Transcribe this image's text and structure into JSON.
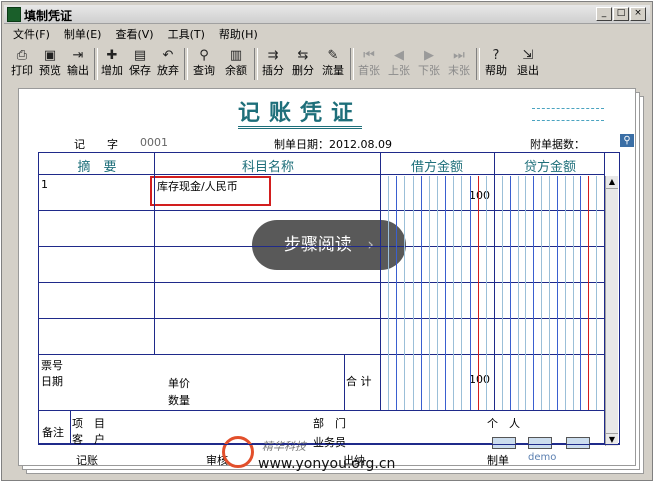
{
  "window": {
    "title": "填制凭证",
    "controls": [
      "_",
      "□",
      "×"
    ]
  },
  "menu": [
    "文件(F)",
    "制单(E)",
    "查看(V)",
    "工具(T)",
    "帮助(H)"
  ],
  "toolbar": [
    {
      "label": "打印",
      "icon": "printer-icon",
      "glyph": "⎙",
      "disabled": false
    },
    {
      "label": "预览",
      "icon": "preview-icon",
      "glyph": "▣",
      "disabled": false
    },
    {
      "label": "输出",
      "icon": "export-icon",
      "glyph": "⇥",
      "disabled": false
    },
    {
      "label": "增加",
      "icon": "add-icon",
      "glyph": "✚",
      "disabled": false
    },
    {
      "label": "保存",
      "icon": "save-icon",
      "glyph": "▤",
      "disabled": false
    },
    {
      "label": "放弃",
      "icon": "undo-icon",
      "glyph": "↶",
      "disabled": false
    },
    {
      "label": "查询",
      "icon": "binoculars-icon",
      "glyph": "⚲",
      "disabled": false
    },
    {
      "label": "余额",
      "icon": "balance-chart-icon",
      "glyph": "▥",
      "disabled": false
    },
    {
      "label": "插分",
      "icon": "insert-line-icon",
      "glyph": "⇉",
      "disabled": false
    },
    {
      "label": "删分",
      "icon": "delete-line-icon",
      "glyph": "⇆",
      "disabled": false
    },
    {
      "label": "流量",
      "icon": "cashflow-icon",
      "glyph": "✎",
      "disabled": false
    },
    {
      "label": "首张",
      "icon": "first-icon",
      "glyph": "⏮",
      "disabled": true
    },
    {
      "label": "上张",
      "icon": "prev-icon",
      "glyph": "◀",
      "disabled": true
    },
    {
      "label": "下张",
      "icon": "next-icon",
      "glyph": "▶",
      "disabled": true
    },
    {
      "label": "末张",
      "icon": "last-icon",
      "glyph": "⏭",
      "disabled": true
    },
    {
      "label": "帮助",
      "icon": "help-icon",
      "glyph": "?",
      "disabled": false
    },
    {
      "label": "退出",
      "icon": "exit-icon",
      "glyph": "⇲",
      "disabled": false
    }
  ],
  "voucher": {
    "title": "记账凭证",
    "type_label": "记　　字",
    "number": "0001",
    "date_label": "制单日期：2012.08.09",
    "attachments_label": "附单据数：",
    "columns": [
      "摘　要",
      "科目名称",
      "借方金额",
      "贷方金额"
    ],
    "rows": [
      {
        "no": "1",
        "summary": "",
        "account": "库存现金/人民币",
        "debit": "100",
        "credit": ""
      },
      {
        "no": "",
        "summary": "",
        "account": "",
        "debit": "",
        "credit": ""
      },
      {
        "no": "",
        "summary": "",
        "account": "",
        "debit": "",
        "credit": ""
      },
      {
        "no": "",
        "summary": "",
        "account": "",
        "debit": "",
        "credit": ""
      },
      {
        "no": "",
        "summary": "",
        "account": "",
        "debit": "",
        "credit": ""
      }
    ],
    "footer": {
      "ticket_no": "票号",
      "date": "日期",
      "unit_price": "单价",
      "quantity": "数量",
      "total_label": "合 计",
      "total_debit": "100",
      "remark": "备注",
      "project": "项　目",
      "customer": "客　户",
      "department": "部　门",
      "salesperson": "业务员",
      "individual": "个　人"
    },
    "signatures": {
      "bookkeeper": "记账",
      "reviewer": "审核",
      "cashier": "出纳",
      "maker": "制单",
      "maker_name": "demo"
    }
  },
  "overlay": {
    "label": "步骤阅读",
    "chevron": "›"
  },
  "watermark": {
    "url": "www.yonyou.org.cn",
    "brand": "精华科技"
  },
  "colors": {
    "accent": "#1e6f7a",
    "grid": "#1f2a8a",
    "highlight": "#d21e1e"
  }
}
